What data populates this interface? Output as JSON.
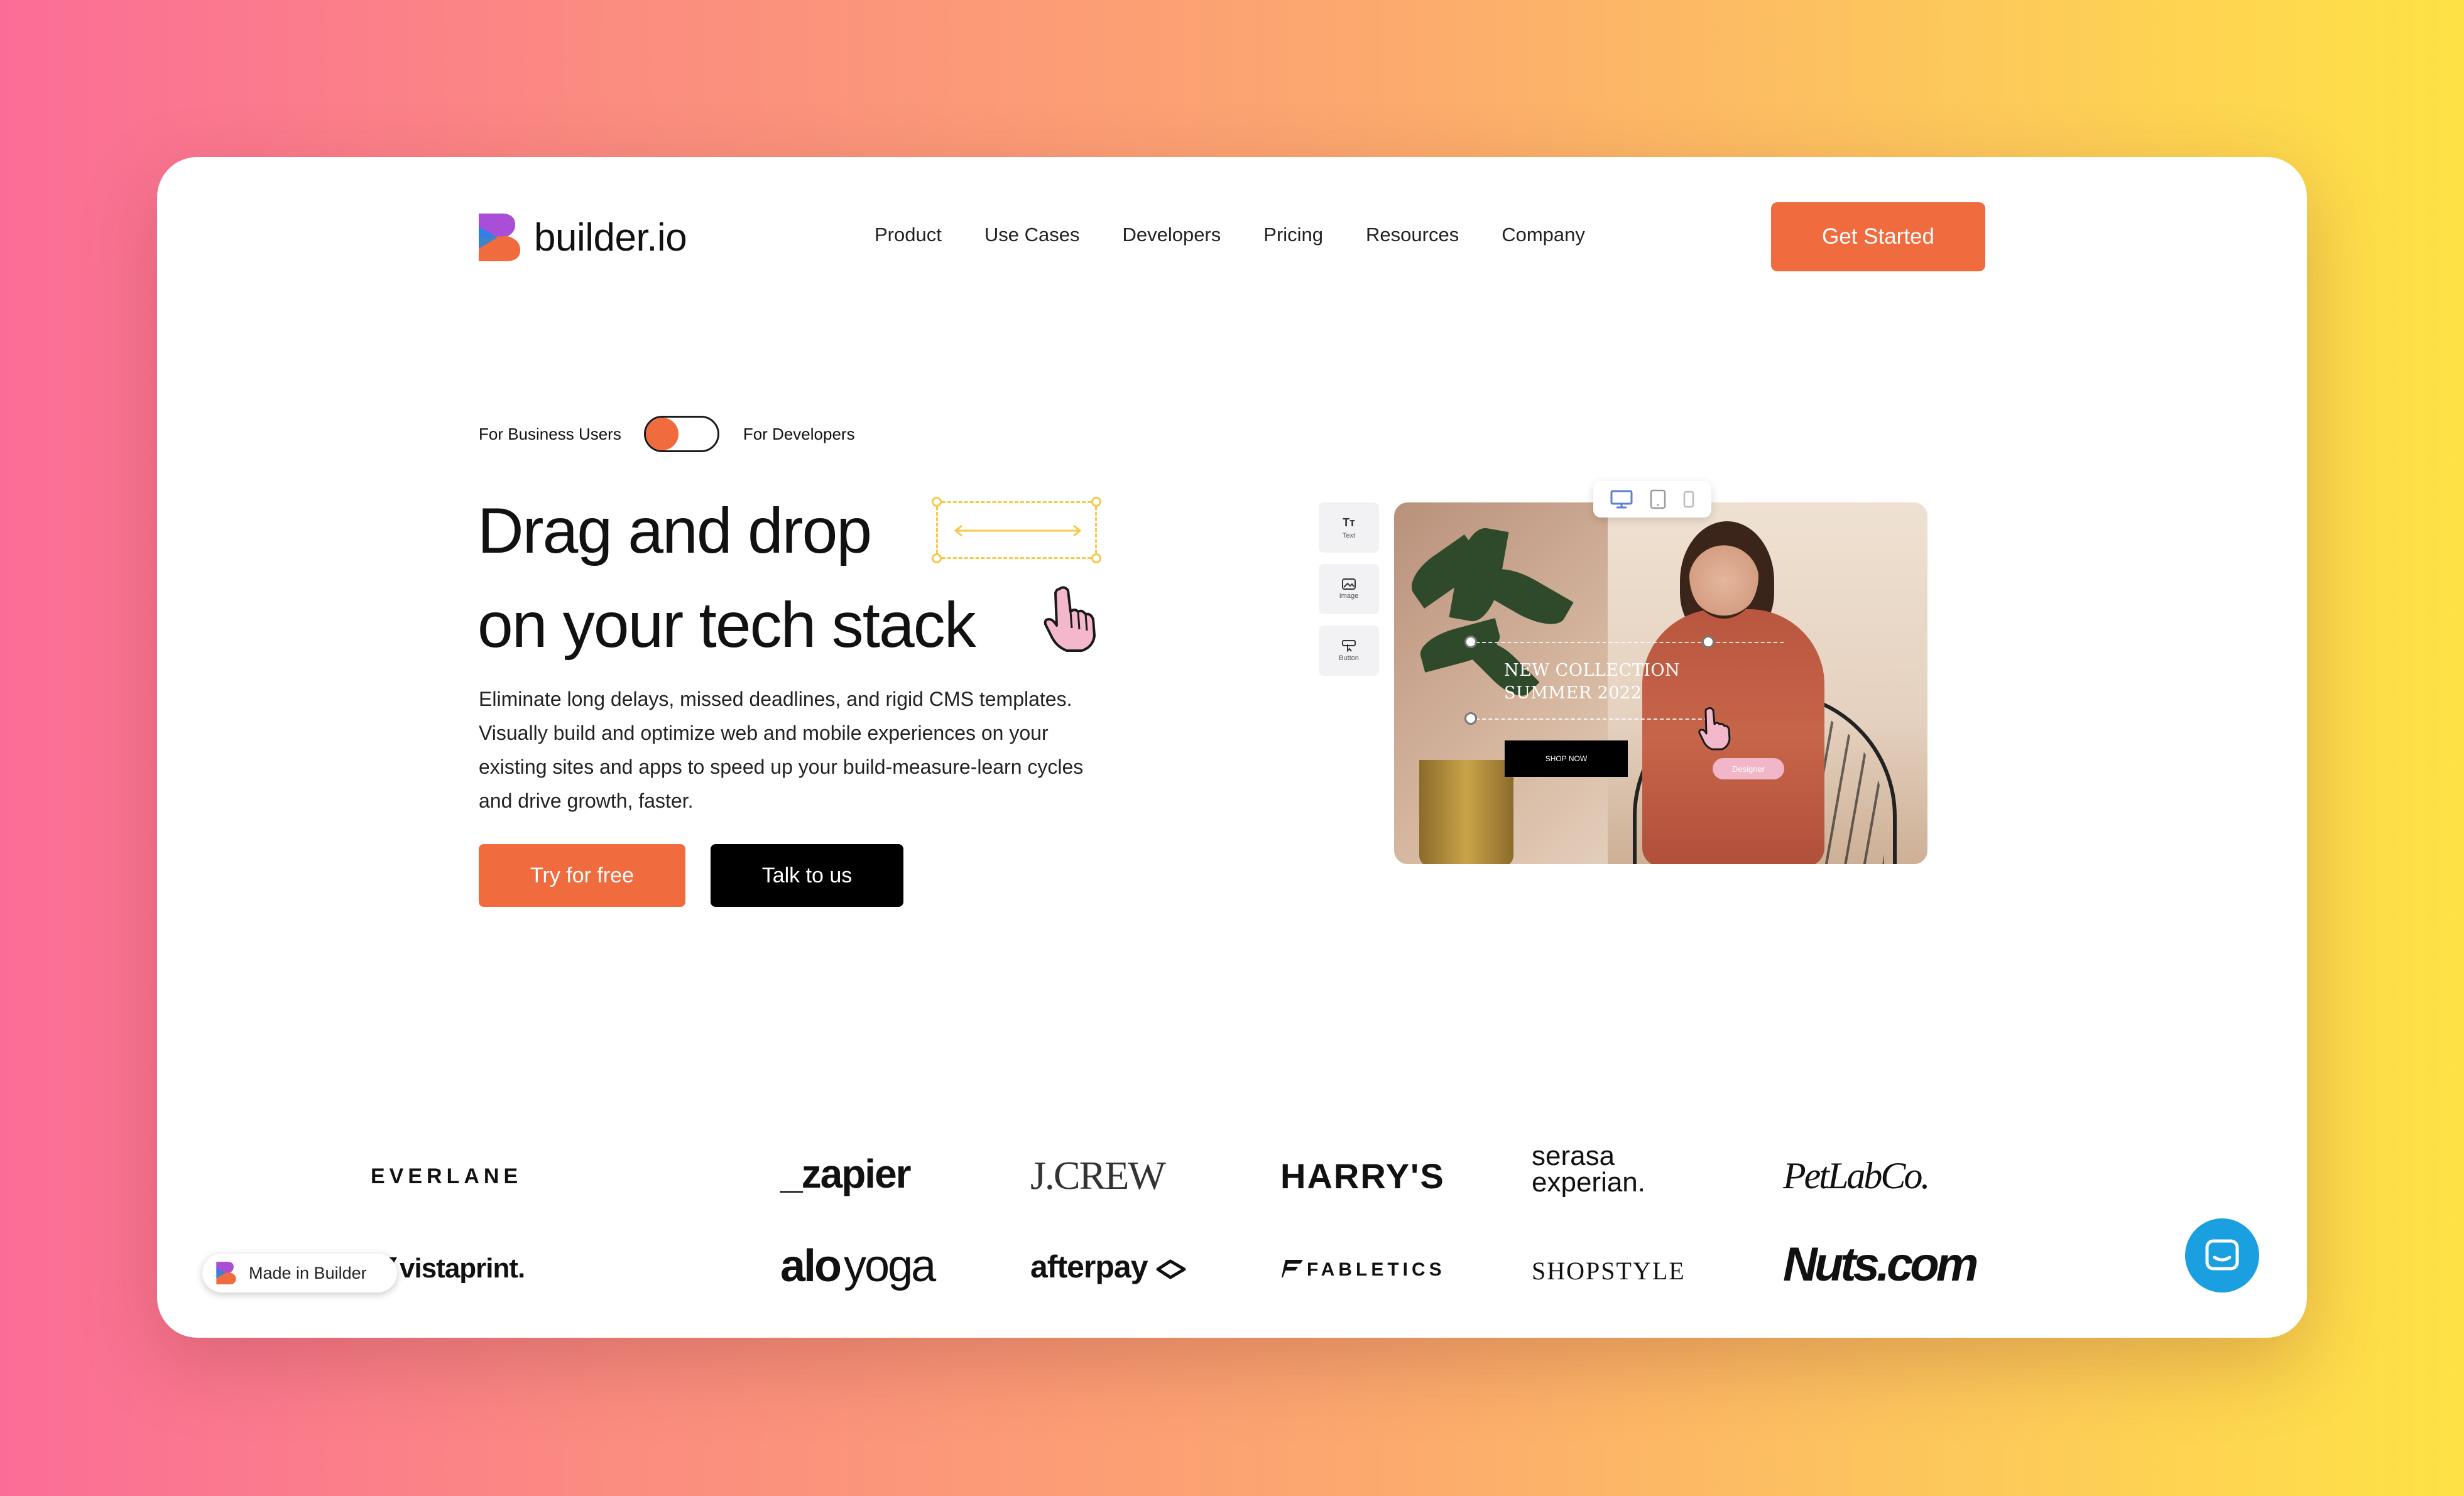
{
  "brand": {
    "name": "builder.io",
    "accent": "#f06b3e",
    "logo_colors": [
      "#f06b3e",
      "#a24be8",
      "#1e88e5"
    ]
  },
  "nav": {
    "items": [
      "Product",
      "Use Cases",
      "Developers",
      "Pricing",
      "Resources",
      "Company"
    ],
    "cta": "Get Started"
  },
  "hero": {
    "toggle_left": "For Business Users",
    "toggle_right": "For Developers",
    "toggle_state": "business",
    "headline_line1": "Drag and drop",
    "headline_line2": "on your tech stack",
    "subtext": "Eliminate long delays, missed deadlines, and rigid CMS templates. Visually build and optimize web and mobile experiences on your existing sites and apps to speed up your build-measure-learn cycles and drive growth, faster.",
    "primary_button": "Try for free",
    "secondary_button": "Talk to us"
  },
  "editor_preview": {
    "tools": [
      {
        "label": "Text",
        "icon": "text-icon",
        "glyph": "Tт"
      },
      {
        "label": "Image",
        "icon": "image-icon"
      },
      {
        "label": "Button",
        "icon": "button-icon"
      }
    ],
    "devices": [
      "desktop-icon",
      "tablet-icon",
      "mobile-icon"
    ],
    "collection_line1": "NEW COLLECTION",
    "collection_line2": "SUMMER 2022",
    "shop_button": "SHOP NOW",
    "designer_tag": "Designer"
  },
  "logos": {
    "row1": [
      "EVERLANE",
      "_zapier",
      "J.CREW",
      "HARRY'S",
      "serasa",
      "experian.",
      "PetLabCo."
    ],
    "row2": [
      "vistaprint.",
      "alo",
      "yoga",
      "afterpay",
      "FABLETICS",
      "SHOPSTYLE",
      "Nuts.com"
    ]
  },
  "badge": {
    "label": "Made in Builder"
  },
  "chat": {
    "icon": "chat-icon",
    "color": "#1a9fe0"
  }
}
